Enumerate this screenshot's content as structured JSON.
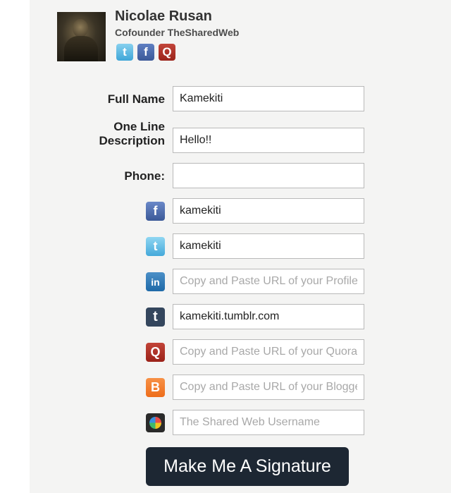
{
  "profile": {
    "name": "Nicolae Rusan",
    "title": "Cofounder TheSharedWeb",
    "social_icons": [
      "twitter-icon",
      "facebook-icon",
      "quora-icon"
    ]
  },
  "form": {
    "full_name": {
      "label": "Full Name",
      "value": "Kamekiti"
    },
    "description": {
      "label_line1": "One Line",
      "label_line2": "Description",
      "value": "Hello!!"
    },
    "phone": {
      "label": "Phone:",
      "value": ""
    },
    "facebook": {
      "icon": "facebook-icon",
      "value": "kamekiti"
    },
    "twitter": {
      "icon": "twitter-icon",
      "value": "kamekiti"
    },
    "linkedin": {
      "icon": "linkedin-icon",
      "value": "",
      "placeholder": "Copy and Paste URL of your Profile"
    },
    "tumblr": {
      "icon": "tumblr-icon",
      "value": "kamekiti.tumblr.com"
    },
    "quora": {
      "icon": "quora-icon",
      "value": "",
      "placeholder": "Copy and Paste URL of your Quora"
    },
    "blogger": {
      "icon": "blogger-icon",
      "value": "",
      "placeholder": "Copy and Paste URL of your Blogger"
    },
    "sharedweb": {
      "icon": "sharedweb-icon",
      "value": "",
      "placeholder": "The Shared Web Username"
    }
  },
  "submit_label": "Make Me A Signature"
}
